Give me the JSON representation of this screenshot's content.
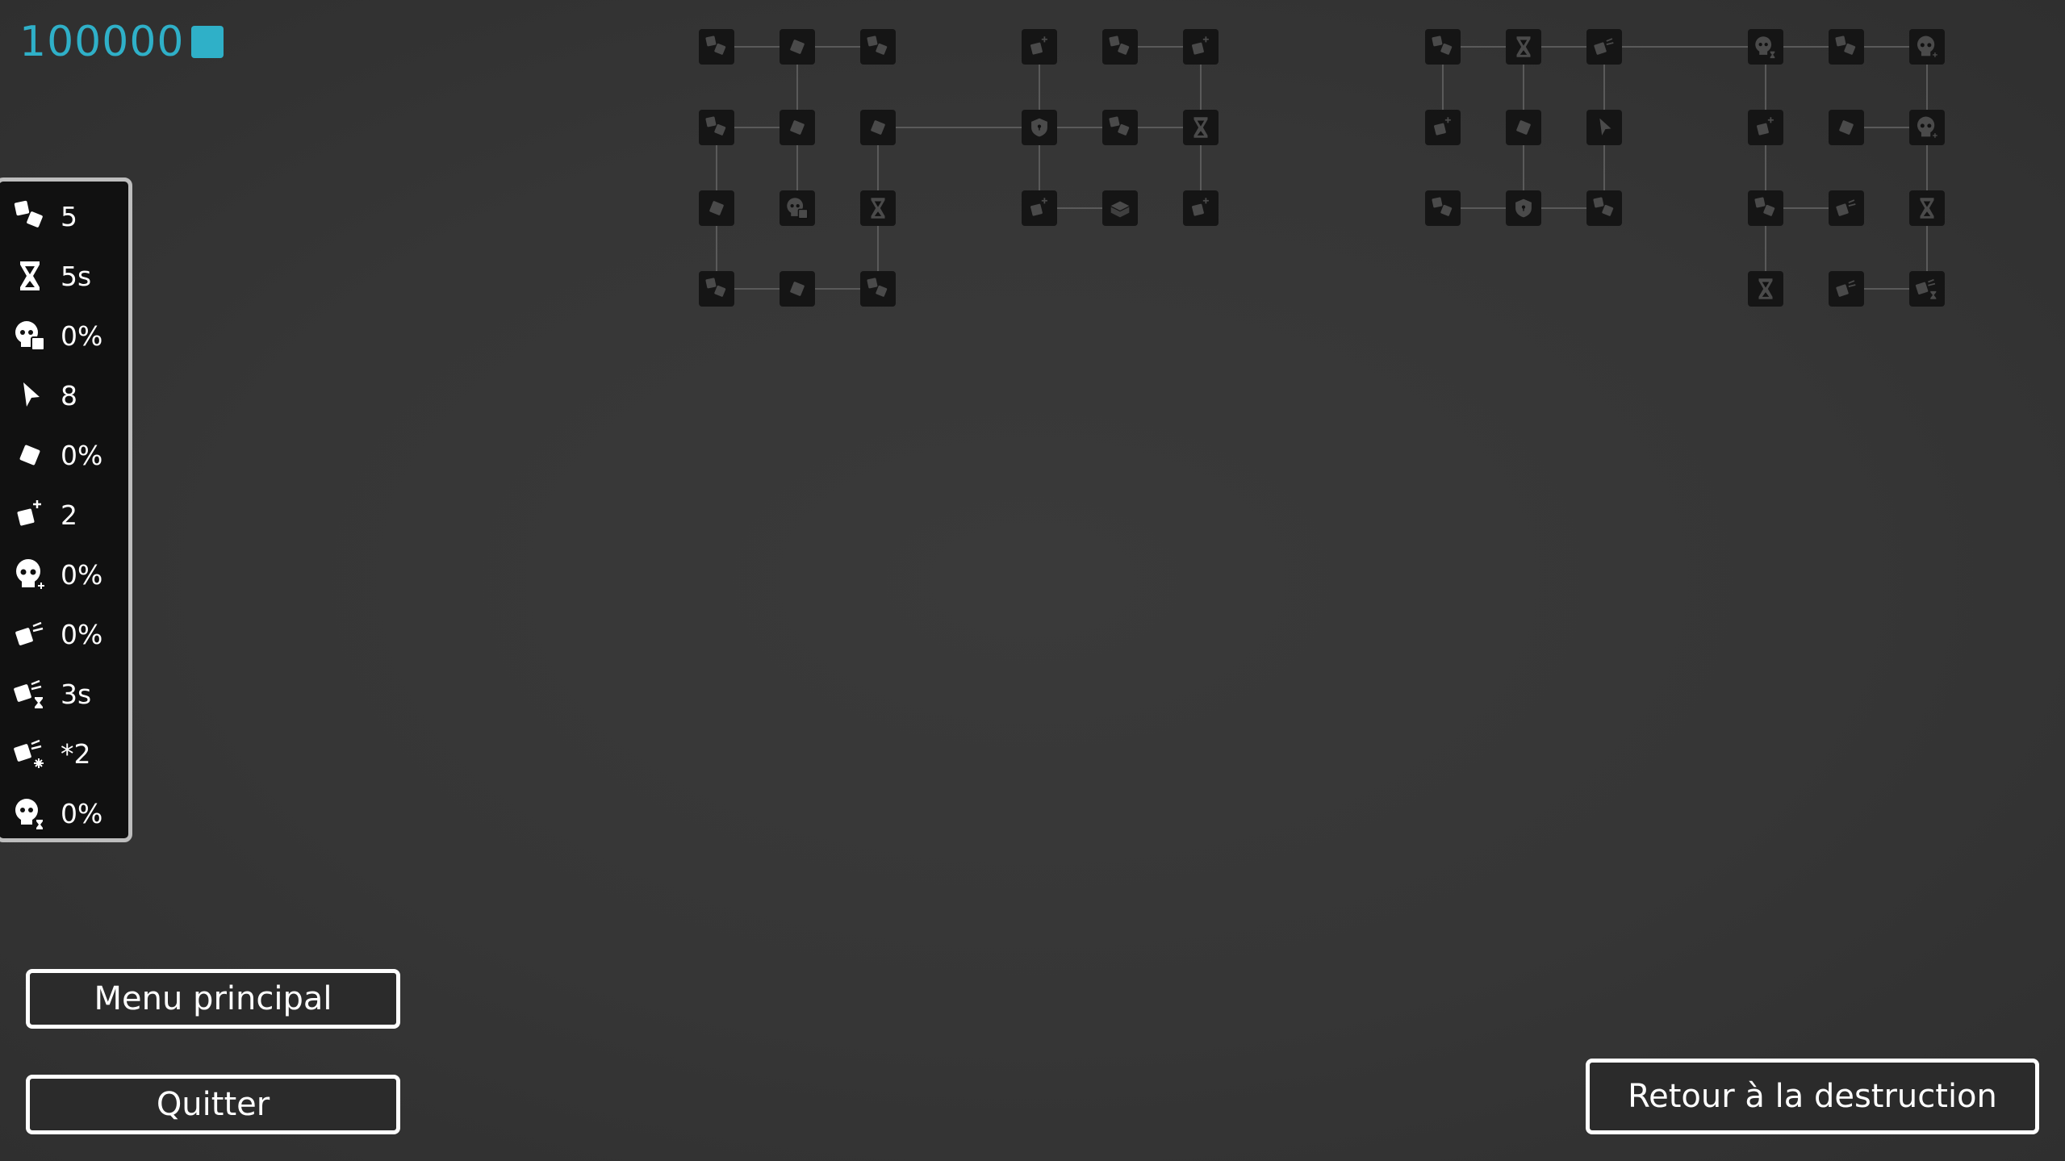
{
  "currency": {
    "amount": "100000",
    "icon": "cube-icon",
    "color": "#2fb0c8"
  },
  "stats": [
    {
      "icon": "cubes-icon",
      "value": "5"
    },
    {
      "icon": "hourglass-icon",
      "value": "5s"
    },
    {
      "icon": "skull-cube-icon",
      "value": "0%"
    },
    {
      "icon": "cursor-icon",
      "value": "8"
    },
    {
      "icon": "cube-icon",
      "value": "0%"
    },
    {
      "icon": "cube-plus-icon",
      "value": "2"
    },
    {
      "icon": "skull-plus-icon",
      "value": "0%"
    },
    {
      "icon": "cube-speed-icon",
      "value": "0%"
    },
    {
      "icon": "cube-speed-hourglass-icon",
      "value": "3s"
    },
    {
      "icon": "cube-speed-star-icon",
      "value": "*2"
    },
    {
      "icon": "skull-hourglass-icon",
      "value": "0%"
    }
  ],
  "buttons": {
    "main_menu": "Menu principal",
    "quit": "Quitter",
    "back": "Retour à la destruction"
  },
  "skill_tree": {
    "nodes": [
      {
        "id": "a1",
        "icon": "cubes-icon"
      },
      {
        "id": "a2",
        "icon": "cube-icon"
      },
      {
        "id": "a3",
        "icon": "cubes-icon"
      },
      {
        "id": "a4",
        "icon": "cubes-icon"
      },
      {
        "id": "a5",
        "icon": "cube-icon"
      },
      {
        "id": "a6",
        "icon": "cube-icon"
      },
      {
        "id": "a7",
        "icon": "cube-icon"
      },
      {
        "id": "a8",
        "icon": "skull-cube-icon"
      },
      {
        "id": "a9",
        "icon": "hourglass-icon"
      },
      {
        "id": "a10",
        "icon": "cubes-icon"
      },
      {
        "id": "a11",
        "icon": "cube-icon"
      },
      {
        "id": "a12",
        "icon": "cubes-icon"
      },
      {
        "id": "b1",
        "icon": "cube-plus-icon"
      },
      {
        "id": "b2",
        "icon": "cubes-icon"
      },
      {
        "id": "b3",
        "icon": "cube-plus-icon"
      },
      {
        "id": "b4",
        "icon": "shield-icon"
      },
      {
        "id": "b5",
        "icon": "cubes-icon"
      },
      {
        "id": "b6",
        "icon": "hourglass-icon"
      },
      {
        "id": "b7",
        "icon": "cube-plus-icon"
      },
      {
        "id": "b8",
        "icon": "chest-icon"
      },
      {
        "id": "b9",
        "icon": "cube-plus-icon"
      },
      {
        "id": "c1",
        "icon": "cubes-icon"
      },
      {
        "id": "c2",
        "icon": "hourglass-icon"
      },
      {
        "id": "c3",
        "icon": "cube-speed-icon"
      },
      {
        "id": "c4",
        "icon": "cube-plus-icon"
      },
      {
        "id": "c5",
        "icon": "cube-icon"
      },
      {
        "id": "c6",
        "icon": "cursor-icon"
      },
      {
        "id": "c7",
        "icon": "cubes-icon"
      },
      {
        "id": "c8",
        "icon": "shield-icon"
      },
      {
        "id": "c9",
        "icon": "cubes-icon"
      },
      {
        "id": "d1",
        "icon": "skull-hourglass-icon"
      },
      {
        "id": "d2",
        "icon": "cubes-icon"
      },
      {
        "id": "d3",
        "icon": "skull-plus-icon"
      },
      {
        "id": "d4",
        "icon": "cube-plus-icon"
      },
      {
        "id": "d5",
        "icon": "cube-icon"
      },
      {
        "id": "d6",
        "icon": "skull-plus-icon"
      },
      {
        "id": "d7",
        "icon": "cubes-icon"
      },
      {
        "id": "d8",
        "icon": "cube-speed-icon"
      },
      {
        "id": "d9",
        "icon": "hourglass-icon"
      },
      {
        "id": "d10",
        "icon": "hourglass-icon"
      },
      {
        "id": "d11",
        "icon": "cube-speed-icon"
      },
      {
        "id": "d12",
        "icon": "cube-speed-hourglass-icon"
      }
    ]
  }
}
